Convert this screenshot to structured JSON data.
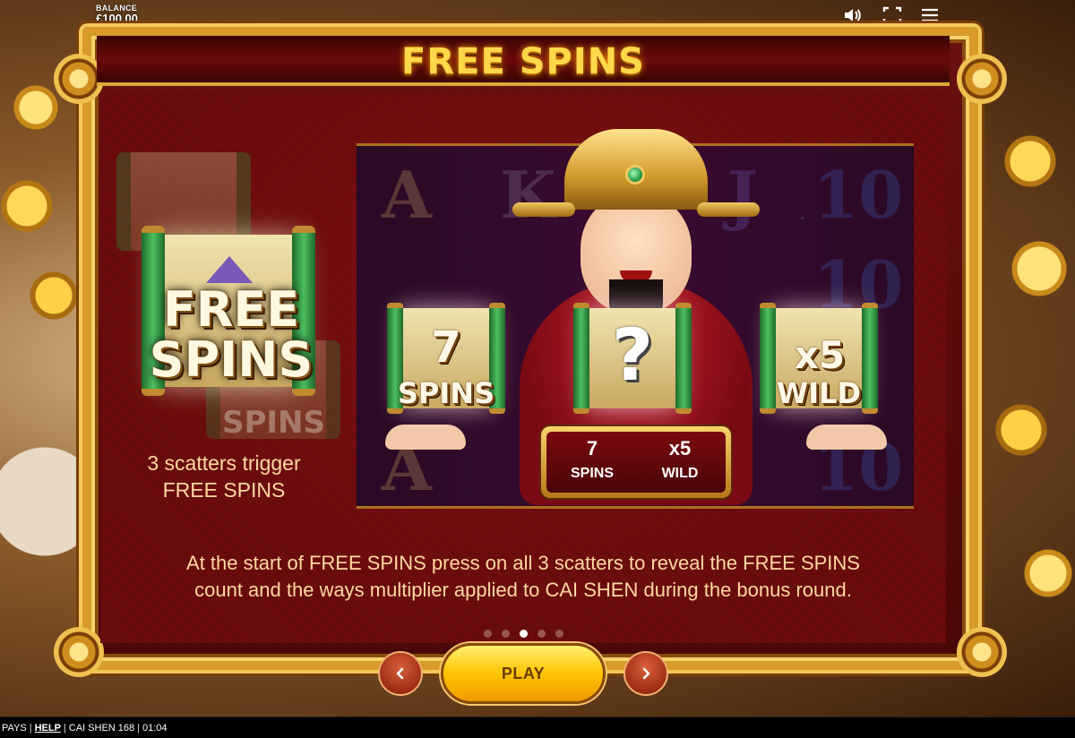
{
  "hud": {
    "balance_label": "BALANCE",
    "balance_value": "£100.00"
  },
  "page": {
    "title": "FREE SPINS"
  },
  "scatter": {
    "back_text": "SPINS",
    "symbol_line1": "FREE",
    "symbol_line2": "SPINS",
    "caption_line1": "3 scatters trigger",
    "caption_line2": "FREE SPINS"
  },
  "reels": {
    "letters": [
      "A",
      "K",
      "J",
      "10",
      "10",
      "10",
      "A"
    ],
    "scroll_spins_value": "7",
    "scroll_spins_label": "SPINS",
    "scroll_mystery": "?",
    "scroll_wild_value": "x5",
    "scroll_wild_label": "WILD"
  },
  "badge": {
    "spins_value": "7",
    "spins_label": "SPINS",
    "wild_value": "x5",
    "wild_label": "WILD"
  },
  "description": {
    "line1": "At the start of FREE SPINS press on all 3 scatters to reveal the FREE SPINS",
    "line2": "count and the ways multiplier applied to CAI SHEN during the bonus round."
  },
  "pagination": {
    "total": 5,
    "active_index": 2
  },
  "controls": {
    "play_label": "PLAY"
  },
  "statusbar": {
    "pays": "PAYS",
    "help": "HELP",
    "game_name": "CAI SHEN 168",
    "clock": "01:04"
  },
  "colors": {
    "title_gold": "#ffd84a",
    "frame_gold": "#d89a2a",
    "panel_red": "#6b0c0c",
    "text_peach": "#ffd8a0",
    "play_yellow": "#ffc400",
    "nav_red": "#9a2a10"
  },
  "icons": [
    "sound-icon",
    "fullscreen-icon",
    "menu-icon",
    "chevron-left-icon",
    "chevron-right-icon"
  ]
}
